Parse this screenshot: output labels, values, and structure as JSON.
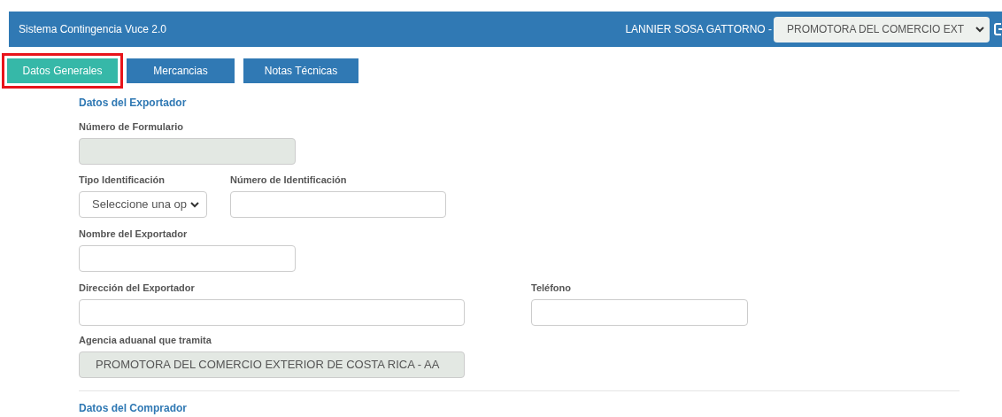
{
  "header": {
    "title": "Sistema Contingencia Vuce 2.0",
    "user": "LANNIER SOSA GATTORNO -",
    "company_select": {
      "value": "PROMOTORA DEL COMERCIO EXT"
    }
  },
  "tabs": [
    {
      "label": "Datos Generales",
      "selected": true,
      "highlighted": true
    },
    {
      "label": "Mercancias",
      "selected": false,
      "highlighted": false
    },
    {
      "label": "Notas Técnicas",
      "selected": false,
      "highlighted": false
    }
  ],
  "exporter_section": {
    "title": "Datos del Exportador",
    "fields": [
      {
        "kind": "input",
        "label": "Número de Formulario",
        "disabled": true
      },
      {
        "kind": "select",
        "label": "Tipo Identificación",
        "value": "Seleccione una op"
      },
      {
        "kind": "input",
        "label": "Número de Identificación",
        "disabled": false
      },
      {
        "kind": "input",
        "label": "Nombre del Exportador",
        "disabled": false
      },
      {
        "kind": "input",
        "label": "Dirección del Exportador",
        "disabled": false
      },
      {
        "kind": "input",
        "label": "Teléfono",
        "disabled": false
      },
      {
        "kind": "input",
        "label": "Agencia aduanal que tramita",
        "disabled": true,
        "value": "PROMOTORA DEL COMERCIO EXTERIOR DE COSTA RICA - AA"
      }
    ]
  },
  "buyer_section": {
    "title": "Datos del Comprador"
  }
}
